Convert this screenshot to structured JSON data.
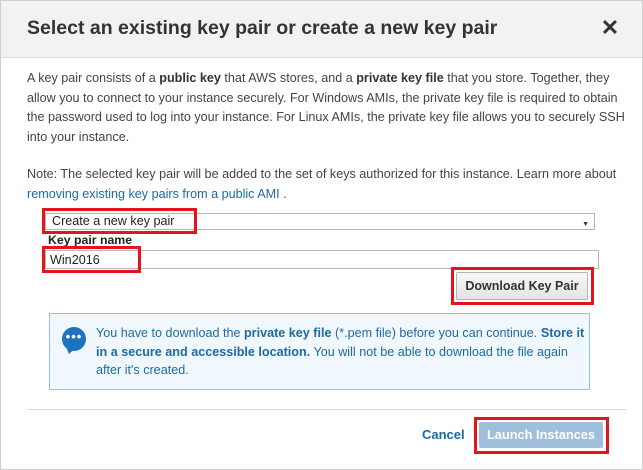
{
  "dialog": {
    "title": "Select an existing key pair or create a new key pair",
    "close_icon": "close-icon"
  },
  "intro": {
    "t1": "A key pair consists of a ",
    "b1": "public key",
    "t2": " that AWS stores, and a ",
    "b2": "private key file",
    "t3": " that you store. Together, they allow you to connect to your instance securely. For Windows AMIs, the private key file is required to obtain the password used to log into your instance. For Linux AMIs, the private key file allows you to securely SSH into your instance."
  },
  "note": {
    "text": "Note: The selected key pair will be added to the set of keys authorized for this instance. Learn more about ",
    "link": "removing existing key pairs from a public AMI",
    "end": " ."
  },
  "keypair": {
    "selected_option": "Create a new key pair",
    "name_label": "Key pair name",
    "name_value": "Win2016",
    "download_label": "Download Key Pair"
  },
  "info": {
    "icon": "chat-bubble-icon",
    "t1": "You have to download the ",
    "b1": "private key file",
    "t2": " (*.pem file) before you can continue. ",
    "b2": "Store it in a secure and accessible location.",
    "t3": " You will not be able to download the file again after it's created."
  },
  "footer": {
    "cancel_label": "Cancel",
    "launch_label": "Launch Instances"
  },
  "colors": {
    "link": "#1a6aa8",
    "info_bg": "#f0f8fd",
    "info_border": "#8fc4e8",
    "highlight": "#e3141b",
    "launch_disabled": "#9fbfdc"
  }
}
